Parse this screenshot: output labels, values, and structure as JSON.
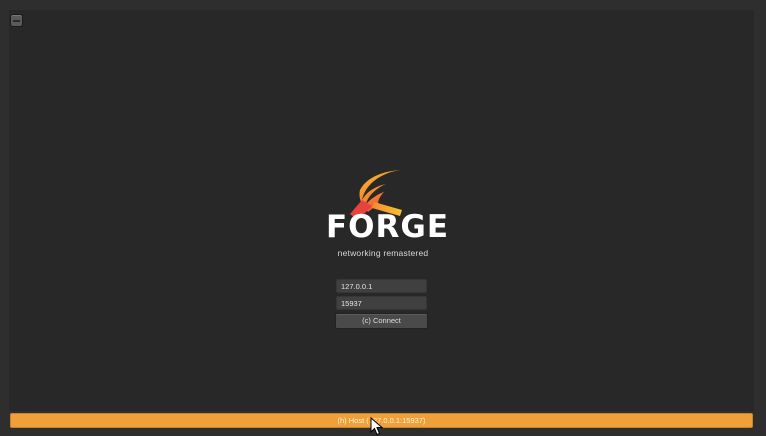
{
  "window": {
    "corner_icon": "minimize-icon"
  },
  "logo": {
    "wordmark": "FORGE",
    "tagline": "networking remastered",
    "colors": {
      "flame_top": "#f7c22f",
      "flame_bottom": "#e8433b",
      "handle": "#ff5a3c"
    }
  },
  "connection": {
    "ip_value": "127.0.0.1",
    "port_value": "15937",
    "connect_label": "(c) Connect"
  },
  "host_button": {
    "label": "(h) Host (127.0.0.1:15937)",
    "color": "#f0a03a"
  },
  "cursor": {
    "icon": "pointer-cursor-icon"
  }
}
